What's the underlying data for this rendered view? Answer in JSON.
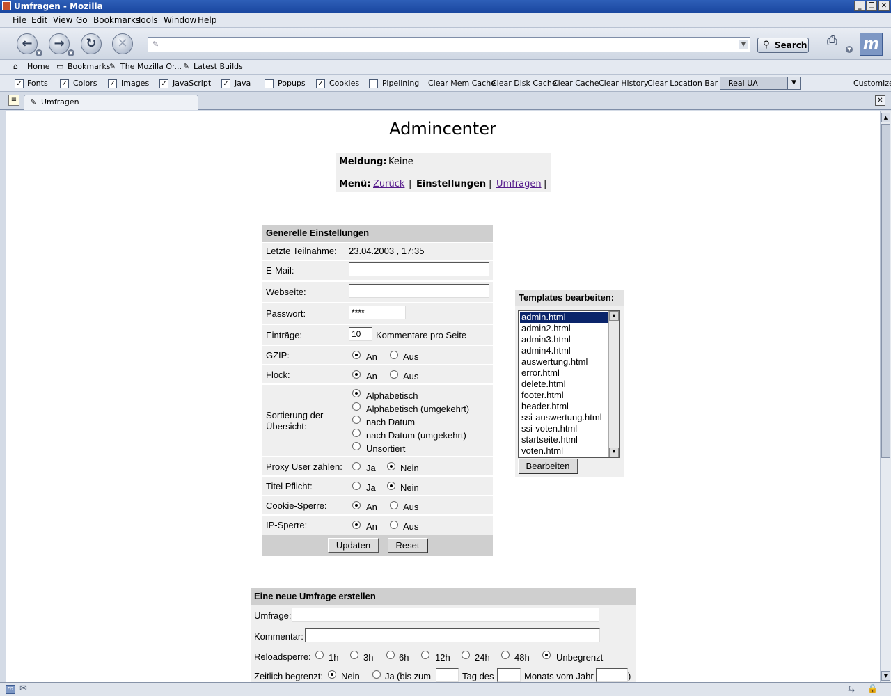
{
  "window": {
    "title": "Umfragen - Mozilla",
    "minimize": "_",
    "maximize": "❐",
    "close": "✕"
  },
  "menu": [
    "File",
    "Edit",
    "View",
    "Go",
    "Bookmarks",
    "Tools",
    "Window",
    "Help"
  ],
  "nav": {
    "back": "←",
    "forward": "→",
    "reload": "↻",
    "stop": "✕",
    "url_value": "",
    "search_label": "Search"
  },
  "personal_bar": [
    "Home",
    "Bookmarks",
    "The Mozilla Or...",
    "Latest Builds"
  ],
  "prefbar": {
    "checks": [
      {
        "label": "Fonts",
        "checked": true
      },
      {
        "label": "Colors",
        "checked": true
      },
      {
        "label": "Images",
        "checked": true
      },
      {
        "label": "JavaScript",
        "checked": true
      },
      {
        "label": "Java",
        "checked": true
      },
      {
        "label": "Popups",
        "checked": false
      },
      {
        "label": "Cookies",
        "checked": true
      },
      {
        "label": "Pipelining",
        "checked": false
      }
    ],
    "buttons": [
      "Clear Mem Cache",
      "Clear Disk Cache",
      "Clear Cache",
      "Clear History",
      "Clear Location Bar"
    ],
    "ua_select": "Real UA",
    "customize": "Customize"
  },
  "tab": {
    "label": "Umfragen"
  },
  "page": {
    "heading": "Admincenter",
    "message_label": "Meldung:",
    "message_value": "Keine",
    "menu_label": "Menü:",
    "menu_back": "Zurück",
    "menu_sep1": "|",
    "menu_settings": "Einstellungen",
    "menu_sep2": "|",
    "menu_polls": "Umfragen",
    "menu_sep3": "|"
  },
  "settings": {
    "title": "Generelle Einstellungen",
    "last_participation_label": "Letzte Teilnahme:",
    "last_participation_value": "23.04.2003 , 17:35",
    "email_label": "E-Mail:",
    "email_value": "",
    "website_label": "Webseite:",
    "website_value": "",
    "password_label": "Passwort:",
    "password_value": "****",
    "entries_label": "Einträge:",
    "entries_value": "10",
    "entries_suffix": "Kommentare pro Seite",
    "gzip_label": "GZIP:",
    "flock_label": "Flock:",
    "on": "An",
    "off": "Aus",
    "yes": "Ja",
    "no": "Nein",
    "sort_label_1": "Sortierung der",
    "sort_label_2": "Übersicht:",
    "sort_options": [
      "Alphabetisch",
      "Alphabetisch (umgekehrt)",
      "nach Datum",
      "nach Datum (umgekehrt)",
      "Unsortiert"
    ],
    "proxy_label": "Proxy User zählen:",
    "title_required_label": "Titel Pflicht:",
    "cookie_lock_label": "Cookie-Sperre:",
    "ip_lock_label": "IP-Sperre:",
    "update_button": "Updaten",
    "reset_button": "Reset"
  },
  "templates": {
    "title": "Templates bearbeiten:",
    "items": [
      "admin.html",
      "admin2.html",
      "admin3.html",
      "admin4.html",
      "auswertung.html",
      "error.html",
      "delete.html",
      "footer.html",
      "header.html",
      "ssi-auswertung.html",
      "ssi-voten.html",
      "startseite.html",
      "voten.html"
    ],
    "selected": "admin.html",
    "edit_button": "Bearbeiten"
  },
  "new_poll": {
    "title": "Eine neue Umfrage erstellen",
    "poll_label": "Umfrage:",
    "comment_label": "Kommentar:",
    "reload_label": "Reloadsperre:",
    "reload_options": [
      "1h",
      "3h",
      "6h",
      "12h",
      "24h",
      "48h",
      "Unbegrenzt"
    ],
    "time_label": "Zeitlich begrenzt:",
    "time_no": "Nein",
    "time_yes": "Ja",
    "until_open": "(bis zum",
    "day_of": "Tag des",
    "month_of_year": "Monats vom Jahr",
    "close_paren": ")"
  }
}
